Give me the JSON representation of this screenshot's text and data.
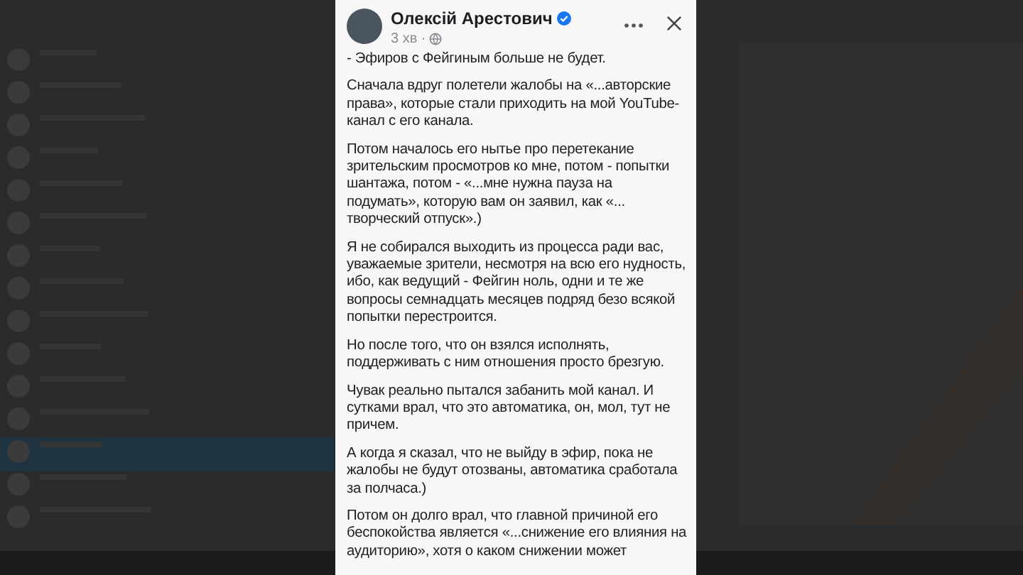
{
  "post": {
    "author": "Олексій Арестович",
    "verified": true,
    "time": "3 хв ·",
    "paragraphs": [
      "- Эфиров с Фейгиным больше не будет.",
      "Сначала вдруг полетели жалобы на «...авторские права», которые стали приходить на мой YouTube-канал с его канала.",
      "Потом  началось его нытье про перетекание зрительским просмотров ко мне, потом - попытки шантажа, потом - «...мне нужна пауза на подумать», которую вам он заявил, как «... творческий отпуск».)",
      "Я не собирался выходить из процесса ради вас, уважаемые зрители, несмотря на всю его нудность, ибо, как ведущий - Фейгин ноль, одни и те же вопросы семнадцать месяцев подряд безо всякой попытки перестроится.",
      "Но после того, что он взялся исполнять, поддерживать с ним отношения просто брезгую.",
      "Чувак реально пытался забанить мой канал. И сутками врал, что это автоматика, он, мол, тут не причем.",
      "А когда я сказал, что не выйду в эфир, пока не жалобы не будут отозваны, автоматика сработала за полчаса.)",
      "Потом он долго врал, что главной причиной его беспокойства является «...снижение его влияния на аудиторию», хотя о каком снижении может"
    ]
  }
}
